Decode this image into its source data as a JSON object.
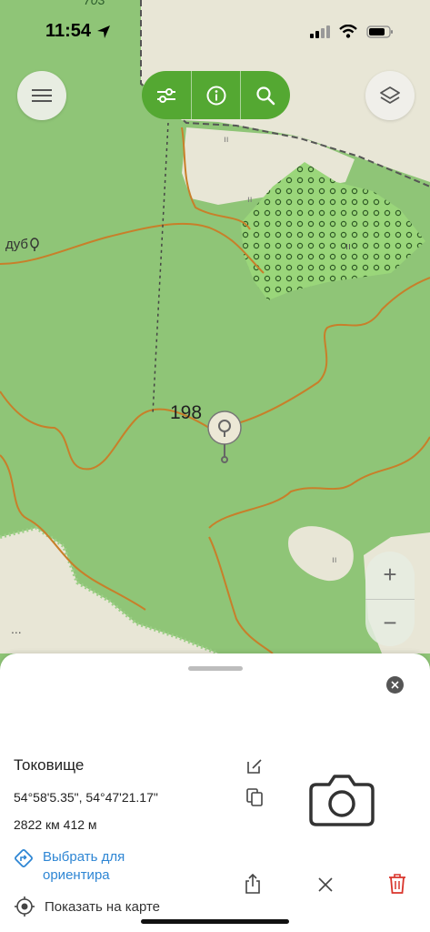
{
  "status_bar": {
    "time": "11:54"
  },
  "toolbar": {
    "filter_icon": "sliders-icon",
    "info_icon": "info-icon",
    "search_icon": "search-icon"
  },
  "map": {
    "top_label": "703",
    "place_label": "дуб",
    "elevation": "198",
    "colors": {
      "forest": "#8fc577",
      "clearing": "#e8e6d6",
      "contour": "#c87f2a",
      "toolbar": "#54a832"
    }
  },
  "zoom": {
    "in": "+",
    "out": "−"
  },
  "sheet": {
    "title": "Токовище",
    "coordinates": "54°58'5.35\", 54°47'21.17\"",
    "distance": "2822 км 412 м",
    "select_landmark": "Выбрать для ориентира",
    "show_on_map": "Показать на карте"
  }
}
